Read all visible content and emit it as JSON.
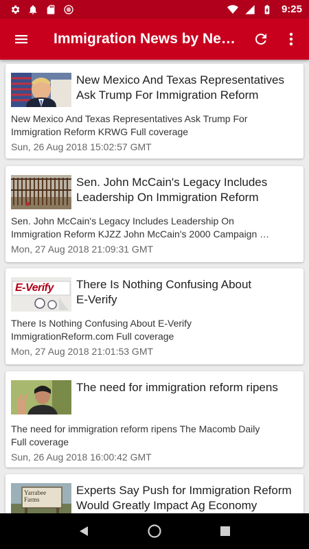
{
  "status_bar": {
    "time": "9:25",
    "icons": [
      "gear-icon",
      "bell-icon",
      "sd-card-icon",
      "sync-icon",
      "wifi-icon",
      "signal-icon",
      "battery-charging-icon"
    ]
  },
  "app_bar": {
    "title": "Immigration News by Ne…",
    "icons": [
      "menu-icon",
      "refresh-icon",
      "more-vert-icon"
    ]
  },
  "colors": {
    "status_bar": "#b0001c",
    "app_bar": "#c8001e",
    "background": "#ececec",
    "card": "#ffffff"
  },
  "articles": [
    {
      "title_line1": "New Mexico And Texas Representatives",
      "title_line2": "Ask Trump For Immigration Reform",
      "desc_line1": "New Mexico And Texas Representatives Ask Trump For",
      "desc_line2": "Immigration Reform  KRWG  Full coverage",
      "date": "Sun, 26 Aug 2018 15:02:57 GMT",
      "thumb": "politician-photo"
    },
    {
      "title_line1": "Sen. John McCain's Legacy Includes",
      "title_line2": "Leadership On Immigration Reform",
      "desc_line1": "Sen. John McCain's Legacy Includes Leadership On",
      "desc_line2": "Immigration Reform  KJZZ  John McCain's 2000 Campaign …",
      "date": "Mon, 27 Aug 2018 21:09:31 GMT",
      "thumb": "border-fence-photo"
    },
    {
      "title_line1": "There Is Nothing Confusing About",
      "title_line2": "E-Verify",
      "desc_line1": "There Is Nothing Confusing About E-Verify",
      "desc_line2": "ImmigrationReform.com  Full coverage",
      "date": "Mon, 27 Aug 2018 21:01:53 GMT",
      "thumb": "everify-logo",
      "thumb_text": "E-Verify"
    },
    {
      "title_line1": "The need for immigration reform ripens",
      "title_line2": "",
      "desc_line1": "The need for immigration reform ripens  The Macomb Daily",
      "desc_line2": "Full coverage",
      "date": "Sun, 26 Aug 2018 16:00:42 GMT",
      "thumb": "woman-raising-hand-photo"
    },
    {
      "title_line1": "Experts Say Push for Immigration Reform",
      "title_line2": "Would Greatly Impact Ag Economy",
      "thumb": "farm-sign-photo",
      "thumb_text": "Yarrabee Farms"
    }
  ],
  "nav_bar": {
    "icons": [
      "back-icon",
      "home-icon",
      "recents-icon"
    ]
  }
}
